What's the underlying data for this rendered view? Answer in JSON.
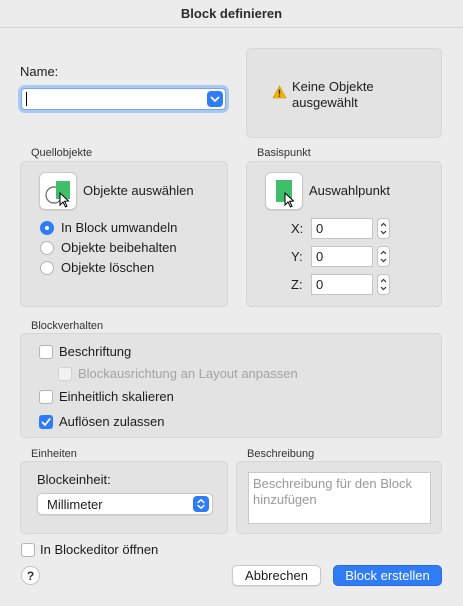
{
  "window": {
    "title": "Block definieren"
  },
  "name": {
    "label": "Name:",
    "value": ""
  },
  "warning": {
    "text_line1": "Keine Objekte",
    "text_line2": "ausgewählt",
    "icon": "warning-icon"
  },
  "source_objects": {
    "section_label": "Quellobjekte",
    "select_button_label": "Objekte auswählen",
    "options": [
      {
        "label": "In Block umwandeln",
        "selected": true
      },
      {
        "label": "Objekte beibehalten",
        "selected": false
      },
      {
        "label": "Objekte löschen",
        "selected": false
      }
    ]
  },
  "base_point": {
    "section_label": "Basispunkt",
    "pick_button_label": "Auswahlpunkt",
    "x_label": "X:",
    "x_value": "0",
    "y_label": "Y:",
    "y_value": "0",
    "z_label": "Z:",
    "z_value": "0"
  },
  "block_behavior": {
    "section_label": "Blockverhalten",
    "annotative_label": "Beschriftung",
    "match_layout_label": "Blockausrichtung an Layout anpassen",
    "uniform_scale_label": "Einheitlich skalieren",
    "allow_explode_label": "Auflösen zulassen"
  },
  "units": {
    "section_label": "Einheiten",
    "block_unit_label": "Blockeinheit:",
    "block_unit_value": "Millimeter"
  },
  "description": {
    "section_label": "Beschreibung",
    "placeholder": "Beschreibung für den Block hinzufügen"
  },
  "footer": {
    "open_in_editor_label": "In Blockeditor öffnen",
    "help_label": "?",
    "cancel_label": "Abbrechen",
    "create_label": "Block erstellen"
  },
  "colors": {
    "accent": "#2f7cf6",
    "block_icon_green": "#3fbf6a",
    "warning_yellow": "#f5b400"
  }
}
